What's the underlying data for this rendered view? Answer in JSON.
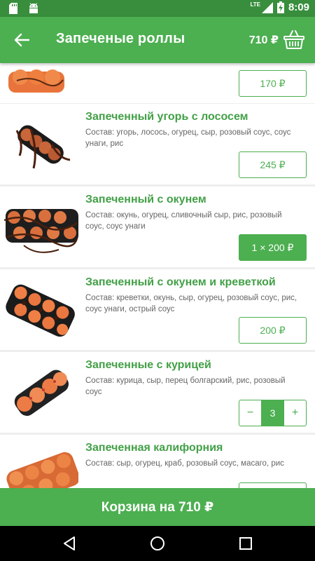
{
  "status_bar": {
    "network": "LTE",
    "time": "8:09",
    "icons": [
      "sd-card-icon",
      "android-icon",
      "signal-icon",
      "battery-charging-icon"
    ]
  },
  "app_bar": {
    "title": "Запеченые роллы",
    "cart_total": "710 ₽",
    "icons": [
      "back-arrow-icon",
      "basket-icon"
    ]
  },
  "items": [
    {
      "title": "",
      "description": "",
      "price_label": "170 ₽",
      "control": "price"
    },
    {
      "title": "Запеченный угорь с лососем",
      "description": "Состав: угорь, лосось, огурец, сыр, розовый соус, соус унаги, рис",
      "price_label": "245 ₽",
      "control": "price"
    },
    {
      "title": "Запеченный с окунем",
      "description": "Состав: окунь, огурец, сливочный сыр, рис, розовый соус, соус унаги",
      "price_label": "1 × 200 ₽",
      "control": "price-in-cart"
    },
    {
      "title": "Запеченный с окунем и креветкой",
      "description": "Состав: креветки, окунь, сыр, огурец, розовый соус, рис, соус унаги, острый соус",
      "price_label": "200 ₽",
      "control": "price"
    },
    {
      "title": "Запеченные с курицей",
      "description": "Состав: курица, сыр, перец болгарский, рис, розовый соус",
      "stepper": {
        "minus": "−",
        "quantity": "3",
        "plus": "+"
      },
      "control": "stepper"
    },
    {
      "title": "Запеченная калифорния",
      "description": "Состав: сыр, огурец, краб, розовый соус, масаго, рис",
      "price_label": "",
      "control": "price"
    }
  ],
  "cart_button": {
    "label": "Корзина на 710 ₽"
  },
  "nav_bar": {
    "icons": [
      "back-triangle-icon",
      "home-circle-icon",
      "recents-square-icon"
    ]
  },
  "colors": {
    "primary": "#4caf50",
    "primary_dark": "#388e3c",
    "title_green": "#43a047",
    "description_gray": "#666666"
  }
}
